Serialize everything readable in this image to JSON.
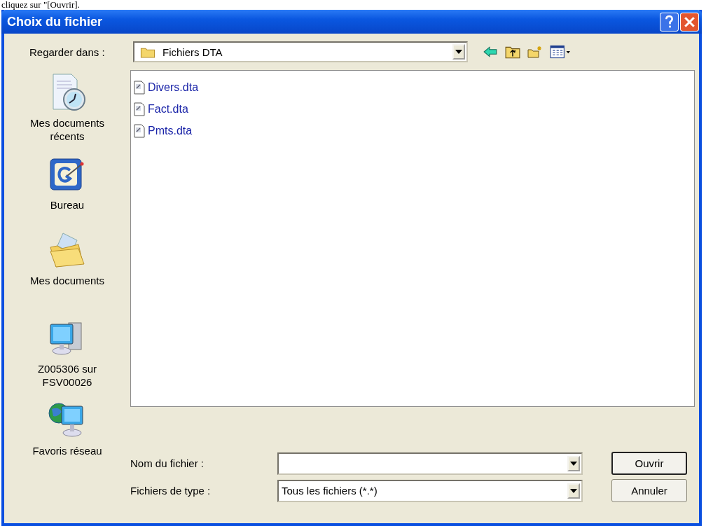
{
  "page_text": "cliquez sur \"[Ouvrir].",
  "window": {
    "title": "Choix du fichier"
  },
  "look_in": {
    "label": "Regarder dans :",
    "value": "Fichiers DTA"
  },
  "places": [
    {
      "label": "Mes documents récents",
      "kind": "recent"
    },
    {
      "label": "Bureau",
      "kind": "desktop"
    },
    {
      "label": "Mes documents",
      "kind": "documents"
    },
    {
      "label": "Z005306 sur FSV00026",
      "kind": "computer"
    },
    {
      "label": "Favoris réseau",
      "kind": "network"
    }
  ],
  "files": [
    {
      "name": "Divers.dta"
    },
    {
      "name": "Fact.dta"
    },
    {
      "name": "Pmts.dta"
    }
  ],
  "file_name": {
    "label": "Nom du fichier :"
  },
  "file_type": {
    "label": "Fichiers de type :",
    "value": "Tous les fichiers (*.*)"
  },
  "buttons": [
    {
      "label": "Ouvrir",
      "default": true
    },
    {
      "label": "Annuler",
      "default": false
    }
  ]
}
